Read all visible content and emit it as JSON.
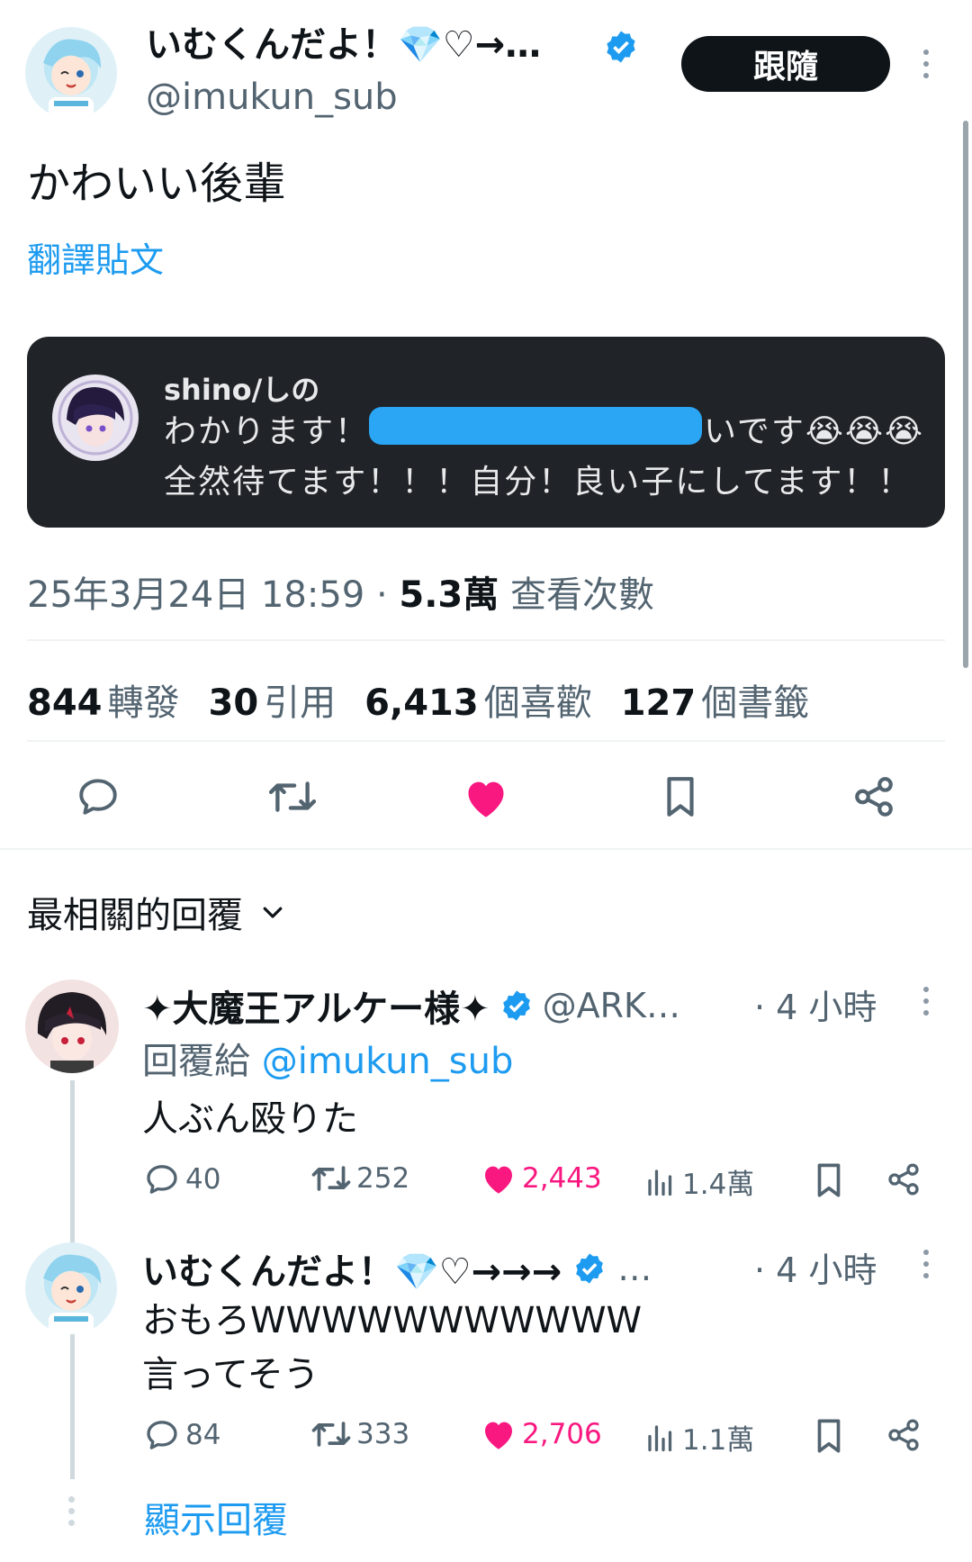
{
  "author": {
    "name": "いむくんだよ！💎♡→…",
    "handle": "@imukun_sub",
    "follow_label": "跟隨"
  },
  "post": {
    "text": "かわいい後輩",
    "translate_label": "翻譯貼文",
    "timestamp": "25年3月24日 18:59",
    "separator": "·",
    "views_value": "5.3萬",
    "views_label": "查看次數"
  },
  "quote": {
    "name": "shino/しの",
    "line1_start": "わかります！",
    "line1_end": "いです😭😭😭",
    "line2": "全然待てます！！！自分！良い子にしてます！！"
  },
  "stats": [
    {
      "value": "844",
      "label": "轉發"
    },
    {
      "value": "30",
      "label": "引用"
    },
    {
      "value": "6,413",
      "label": "個喜歡"
    },
    {
      "value": "127",
      "label": "個書籤"
    }
  ],
  "actions": {
    "reply_icon": "comment-icon",
    "retweet_icon": "retweet-icon",
    "like_icon": "heart-filled-icon",
    "bookmark_icon": "bookmark-icon",
    "share_icon": "share-icon"
  },
  "replies_header": {
    "label": "最相關的回覆"
  },
  "replies": [
    {
      "name": "✦大魔王アルケー様✦",
      "handle": "@ARK…",
      "time": "· 4 小時",
      "reply_to_prefix": "回覆給",
      "reply_to_handle": "@imukun_sub",
      "lines": [
        "人ぶん殴りた"
      ],
      "comments": "40",
      "retweets": "252",
      "likes": "2,443",
      "views": "1.4萬"
    },
    {
      "name": "いむくんだよ！💎♡→→→",
      "handle": "…",
      "time": "· 4 小時",
      "lines": [
        "おもろWWWWWWWWWWW",
        "言ってそう"
      ],
      "comments": "84",
      "retweets": "333",
      "likes": "2,706",
      "views": "1.1萬"
    }
  ],
  "show_replies_label": "顯示回覆",
  "colors": {
    "accent": "#1d9bf0",
    "like": "#f91880",
    "text": "#0f1419",
    "muted": "#536471",
    "quote_bg": "#202327"
  }
}
